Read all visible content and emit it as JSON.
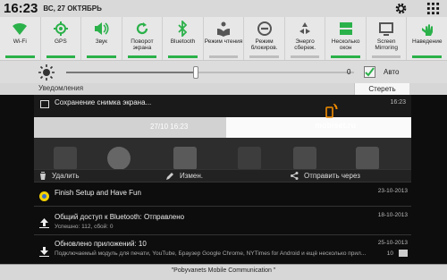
{
  "status": {
    "time": "16:23",
    "date": "ВС, 27 ОКТЯБРЬ",
    "icons": [
      "gear-icon",
      "grid-icon"
    ]
  },
  "toggles": [
    {
      "label": "Wi-Fi",
      "icon": "wifi-icon",
      "on": true
    },
    {
      "label": "GPS",
      "icon": "gps-icon",
      "on": true
    },
    {
      "label": "Звук",
      "icon": "sound-icon",
      "on": true
    },
    {
      "label": "Поворот экрана",
      "icon": "rotate-icon",
      "on": true
    },
    {
      "label": "Bluetooth",
      "icon": "bluetooth-icon",
      "on": true
    },
    {
      "label": "Режим чтения",
      "icon": "reading-mode-icon",
      "on": false
    },
    {
      "label": "Режим блокиров.",
      "icon": "block-mode-icon",
      "on": false
    },
    {
      "label": "Энерго сбереж.",
      "icon": "power-saving-icon",
      "on": false
    },
    {
      "label": "Несколько окон",
      "icon": "multi-window-icon",
      "on": true
    },
    {
      "label": "Screen Mirroring",
      "icon": "screen-mirroring-icon",
      "on": false
    },
    {
      "label": "Наведение",
      "icon": "hover-icon",
      "on": true
    }
  ],
  "brightness": {
    "value_label": "0",
    "level": 0.45,
    "auto_label": "Авто",
    "auto_checked": true
  },
  "notifications": {
    "header": "Уведомления",
    "clear_label": "Стереть",
    "screenshot": {
      "title": "Сохранение снимка экрана...",
      "time": "16:23",
      "preview_clock": "27/10 16:23",
      "actions": {
        "delete": "Удалить",
        "edit": "Измен.",
        "share": "Отправить через"
      }
    },
    "items": [
      {
        "title": "Finish Setup and Have Fun",
        "subtitle": "",
        "time": "23-10-2013",
        "icon": "setup-icon"
      },
      {
        "title": "Общий доступ к Bluetooth: Отправлено",
        "subtitle": "Успешно: 112, сбой: 0",
        "time": "18-10-2013",
        "icon": "upload-icon"
      },
      {
        "title": "Обновлено приложений: 10",
        "subtitle": "Подключаемый модуль для печати, YouTube, Браузер Google Chrome, NYTimes for Android и ещё несколько прил...",
        "time": "25-10-2013",
        "count": "10",
        "icon": "download-icon"
      }
    ]
  },
  "watermark": "mobiset.ru",
  "footer": "\"Pobyvanets Mobile Communication \"",
  "colors": {
    "toggle_on": "#2bb14a",
    "toggle_off": "#bdbdbd",
    "watermark_accent": "#f28c00"
  }
}
